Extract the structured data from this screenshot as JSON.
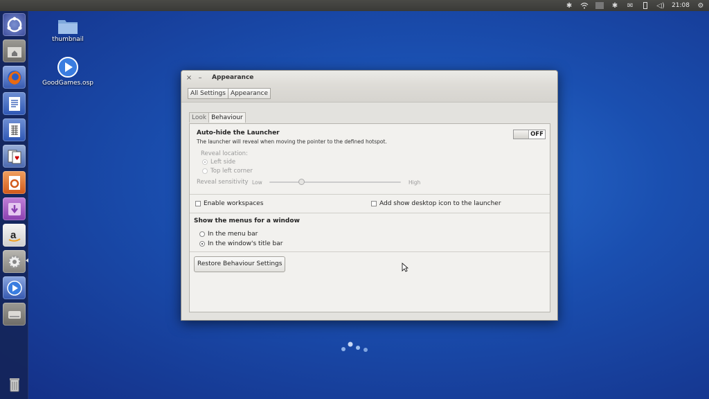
{
  "top_panel": {
    "clock": "21:08",
    "indicators": [
      "bluetooth-icon",
      "wifi-icon",
      "keyboard-icon",
      "bluetooth-icon",
      "mail-icon",
      "battery-icon",
      "volume-icon",
      "gear-icon"
    ]
  },
  "launcher": {
    "items": [
      "ubuntu-dash-icon",
      "files-icon",
      "firefox-icon",
      "writer-icon",
      "calc-icon",
      "impress-icon",
      "software-center-icon",
      "amazon-icon",
      "system-settings-icon",
      "media-player-icon",
      "disk-icon",
      "trash-icon"
    ]
  },
  "desktop": {
    "icons": [
      {
        "label": "thumbnail"
      },
      {
        "label": "GoodGames.osp"
      }
    ]
  },
  "window": {
    "title": "Appearance",
    "breadcrumbs": [
      "All Settings",
      "Appearance"
    ],
    "tabs": [
      "Look",
      "Behaviour"
    ],
    "autohide": {
      "title": "Auto-hide the Launcher",
      "description": "The launcher will reveal when moving the pointer to the defined hotspot.",
      "toggle": "OFF",
      "reveal_location_label": "Reveal location:",
      "reveal_options": [
        "Left side",
        "Top left corner"
      ],
      "sensitivity_label": "Reveal sensitivity",
      "low": "Low",
      "high": "High"
    },
    "workspaces_label": "Enable workspaces",
    "desktop_icon_label": "Add show desktop icon to the launcher",
    "menus": {
      "title": "Show the menus for a window",
      "options": [
        "In the menu bar",
        "In the window's title bar"
      ]
    },
    "restore_button": "Restore Behaviour Settings"
  },
  "colors": {
    "desktop_blue": "#1a4fb0",
    "panel": "#3c3c39",
    "window_bg": "#f2f1ee"
  }
}
